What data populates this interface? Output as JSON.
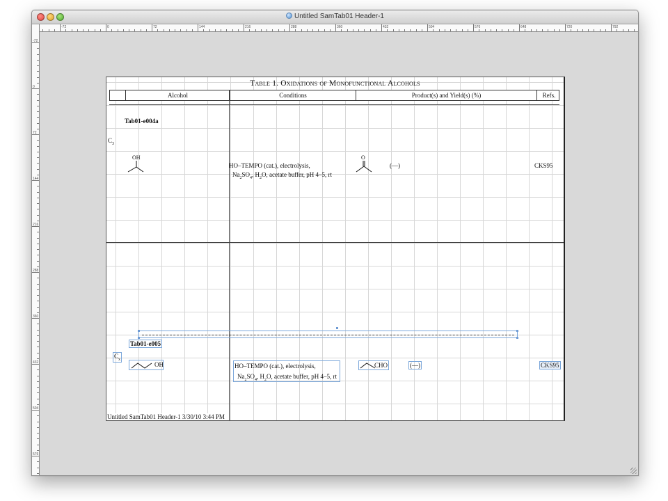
{
  "window": {
    "title": "Untitled SamTab01 Header-1"
  },
  "ruler": {
    "h_ticks": [
      "-72",
      "0",
      "72",
      "144",
      "216",
      "288",
      "360",
      "432",
      "504",
      "576",
      "648",
      "720",
      "792"
    ],
    "v_ticks": [
      "-72",
      "0",
      "72",
      "144",
      "216",
      "288",
      "360",
      "432",
      "504",
      "576"
    ]
  },
  "table": {
    "title": "Table 1. Oxidations of Monofunctional Alcohols",
    "headers": {
      "alcohol": "Alcohol",
      "conditions": "Conditions",
      "products": "Product(s) and Yield(s) (%)",
      "refs": "Refs."
    },
    "entry1": {
      "id": "Tab01-e004a",
      "carbon_main": "C",
      "carbon_sub": "3",
      "alcohol_label": "OH",
      "conditions_line1": "HO–TEMPO (cat.), electrolysis,",
      "conditions_line2_a": "Na",
      "conditions_line2_b": "2",
      "conditions_line2_c": "SO",
      "conditions_line2_d": "4",
      "conditions_line2_e": ", H",
      "conditions_line2_f": "2",
      "conditions_line2_g": "O, acetate buffer, pH 4–5, rt",
      "product_label": "O",
      "yield": "(—)",
      "ref": "CKS95"
    },
    "entry2": {
      "id": "Tab01-e005",
      "carbon_main": "C",
      "carbon_sub": "x",
      "alcohol_label": "OH",
      "conditions_line1": "HO–TEMPO (cat.), electrolysis,",
      "conditions_line2_a": "Na",
      "conditions_line2_b": "2",
      "conditions_line2_c": "SO",
      "conditions_line2_d": "4",
      "conditions_line2_e": ", H",
      "conditions_line2_f": "2",
      "conditions_line2_g": "O, acetate buffer, pH 4–5, rt",
      "product_label": "CHO",
      "yield": "(—)",
      "ref": "CKS95"
    }
  },
  "footer": "Untitled SamTab01 Header-1 3/30/10 3:44 PM"
}
